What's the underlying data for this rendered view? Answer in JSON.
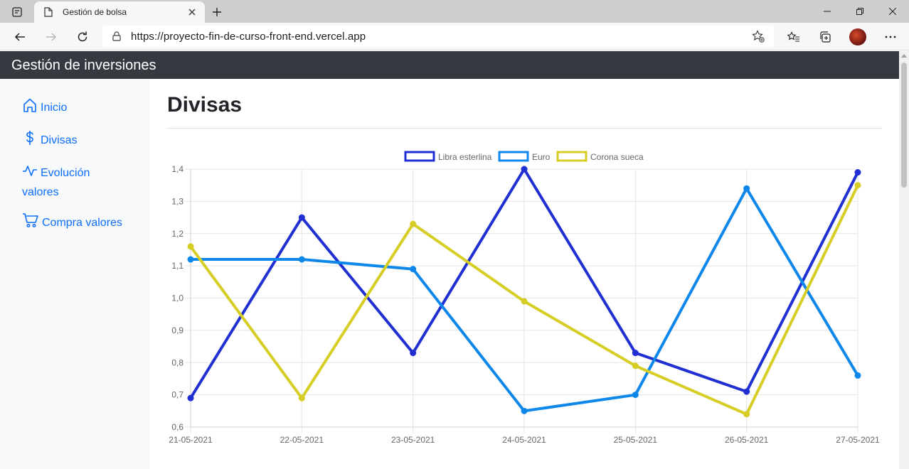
{
  "browser": {
    "tab_title": "Gestión de bolsa",
    "url": "https://proyecto-fin-de-curso-front-end.vercel.app",
    "icons": [
      "tab-actions-icon",
      "page-icon",
      "close-icon",
      "plus-icon",
      "minimize-icon",
      "restore-icon",
      "window-close-icon",
      "back-icon",
      "forward-icon",
      "refresh-icon",
      "lock-icon",
      "add-favorite-icon",
      "favorites-icon",
      "collections-icon",
      "more-icon"
    ]
  },
  "app": {
    "brand": "Gestión de inversiones",
    "nav_color": "#0d6efd",
    "navbar_color": "#343a40"
  },
  "sidebar": {
    "items": [
      {
        "label": "Inicio",
        "icon": "house-icon"
      },
      {
        "label": "Divisas",
        "icon": "dollar-icon"
      },
      {
        "label": "Evolución valores",
        "label_line1": "Evolución",
        "label_line2": "valores",
        "icon": "activity-icon"
      },
      {
        "label": "Compra valores",
        "icon": "cart-icon"
      }
    ]
  },
  "main": {
    "title": "Divisas"
  },
  "chart_data": {
    "type": "line",
    "categories": [
      "21-05-2021",
      "22-05-2021",
      "23-05-2021",
      "24-05-2021",
      "25-05-2021",
      "26-05-2021",
      "27-05-2021"
    ],
    "ylim": [
      0.6,
      1.4
    ],
    "yticks": [
      "1,4",
      "1,3",
      "1,2",
      "1,1",
      "1,0",
      "0,9",
      "0,8",
      "0,7",
      "0,6"
    ],
    "grid": true,
    "legend_position": "top",
    "series": [
      {
        "name": "Libra esterlina",
        "color": "#1f2fd1",
        "values": [
          0.69,
          1.25,
          0.83,
          1.4,
          0.83,
          0.71,
          1.39
        ]
      },
      {
        "name": "Euro",
        "color": "#0d87ea",
        "values": [
          1.12,
          1.12,
          1.09,
          0.65,
          0.7,
          1.34,
          0.76
        ]
      },
      {
        "name": "Corona sueca",
        "color": "#d6cd25",
        "values": [
          1.16,
          0.69,
          1.23,
          0.99,
          0.79,
          0.64,
          1.35
        ]
      }
    ]
  }
}
